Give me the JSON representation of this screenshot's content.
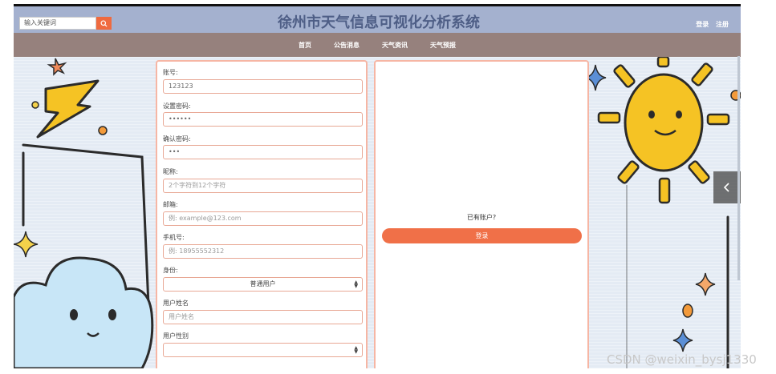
{
  "header": {
    "search_placeholder": "输入关键词",
    "title": "徐州市天气信息可视化分析系统",
    "login_link": "登录",
    "register_link": "注册"
  },
  "nav": {
    "items": [
      "首页",
      "公告消息",
      "天气资讯",
      "天气预报"
    ]
  },
  "form": {
    "fields": [
      {
        "label": "账号:",
        "value": "123123",
        "placeholder": ""
      },
      {
        "label": "设置密码:",
        "value": "••••••",
        "placeholder": ""
      },
      {
        "label": "确认密码:",
        "value": "•••",
        "placeholder": ""
      },
      {
        "label": "昵称:",
        "value": "",
        "placeholder": "2个字符到12个字符"
      },
      {
        "label": "邮箱:",
        "value": "",
        "placeholder": "例: example@123.com"
      },
      {
        "label": "手机号:",
        "value": "",
        "placeholder": "例: 18955552312"
      },
      {
        "label": "身份:",
        "value": "普通用户",
        "placeholder": ""
      },
      {
        "label": "用户姓名",
        "value": "",
        "placeholder": "用户姓名"
      },
      {
        "label": "用户性别",
        "value": "",
        "placeholder": ""
      }
    ]
  },
  "login_panel": {
    "prompt": "已有账户?",
    "button_label": "登录"
  },
  "watermark": "CSDN @weixin_bysj1330",
  "colors": {
    "header_bg": "#a4b1cf",
    "nav_bg": "#96817d",
    "accent": "#f07048",
    "panel_border": "#f6b6a4"
  },
  "icons": {
    "search": "search-icon",
    "carousel": "chevron-left-icon"
  }
}
